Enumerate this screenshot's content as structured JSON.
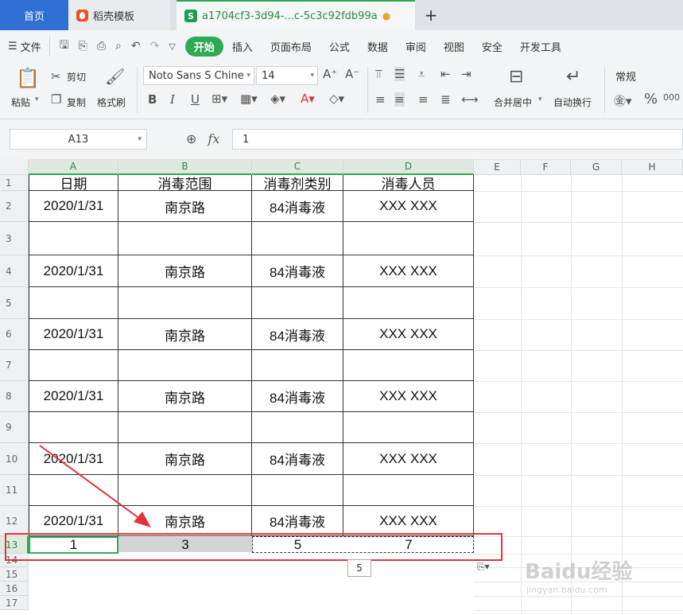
{
  "tabs": {
    "home": "首页",
    "template": "稻壳模板",
    "file": "a1704cf3-3d94-...c-5c3c92fdb99a",
    "add": "+"
  },
  "menu": {
    "file": "文件",
    "items": [
      "开始",
      "插入",
      "页面布局",
      "公式",
      "数据",
      "审阅",
      "视图",
      "安全",
      "开发工具"
    ]
  },
  "ribbon": {
    "paste": "粘贴",
    "cut": "剪切",
    "copy": "复制",
    "format_painter": "格式刷",
    "font_name": "Noto Sans S Chine",
    "font_size": "14",
    "merge_center": "合并居中",
    "wrap_text": "自动换行",
    "number_format": "常规"
  },
  "formula_bar": {
    "name_box": "A13",
    "fx": "fx",
    "value": "1"
  },
  "columns": [
    "A",
    "B",
    "C",
    "D",
    "E",
    "F",
    "G",
    "H"
  ],
  "rows": [
    "1",
    "2",
    "3",
    "4",
    "5",
    "6",
    "7",
    "8",
    "9",
    "10",
    "11",
    "12",
    "13",
    "14",
    "15",
    "16",
    "17"
  ],
  "header": [
    "日期",
    "消毒范围",
    "消毒剂类别",
    "消毒人员"
  ],
  "record": {
    "date": "2020/1/31",
    "scope": "南京路",
    "agent": "84消毒液",
    "person": "XXX XXX"
  },
  "row13": [
    "1",
    "3",
    "5",
    "7"
  ],
  "tooltip": "5",
  "watermark": {
    "brand": "Baidu经验",
    "url": "jingyan.baidu.com"
  },
  "colors": {
    "accent": "#2eaa55",
    "home_tab": "#2f6fd4",
    "annotation": "#e0343a"
  }
}
